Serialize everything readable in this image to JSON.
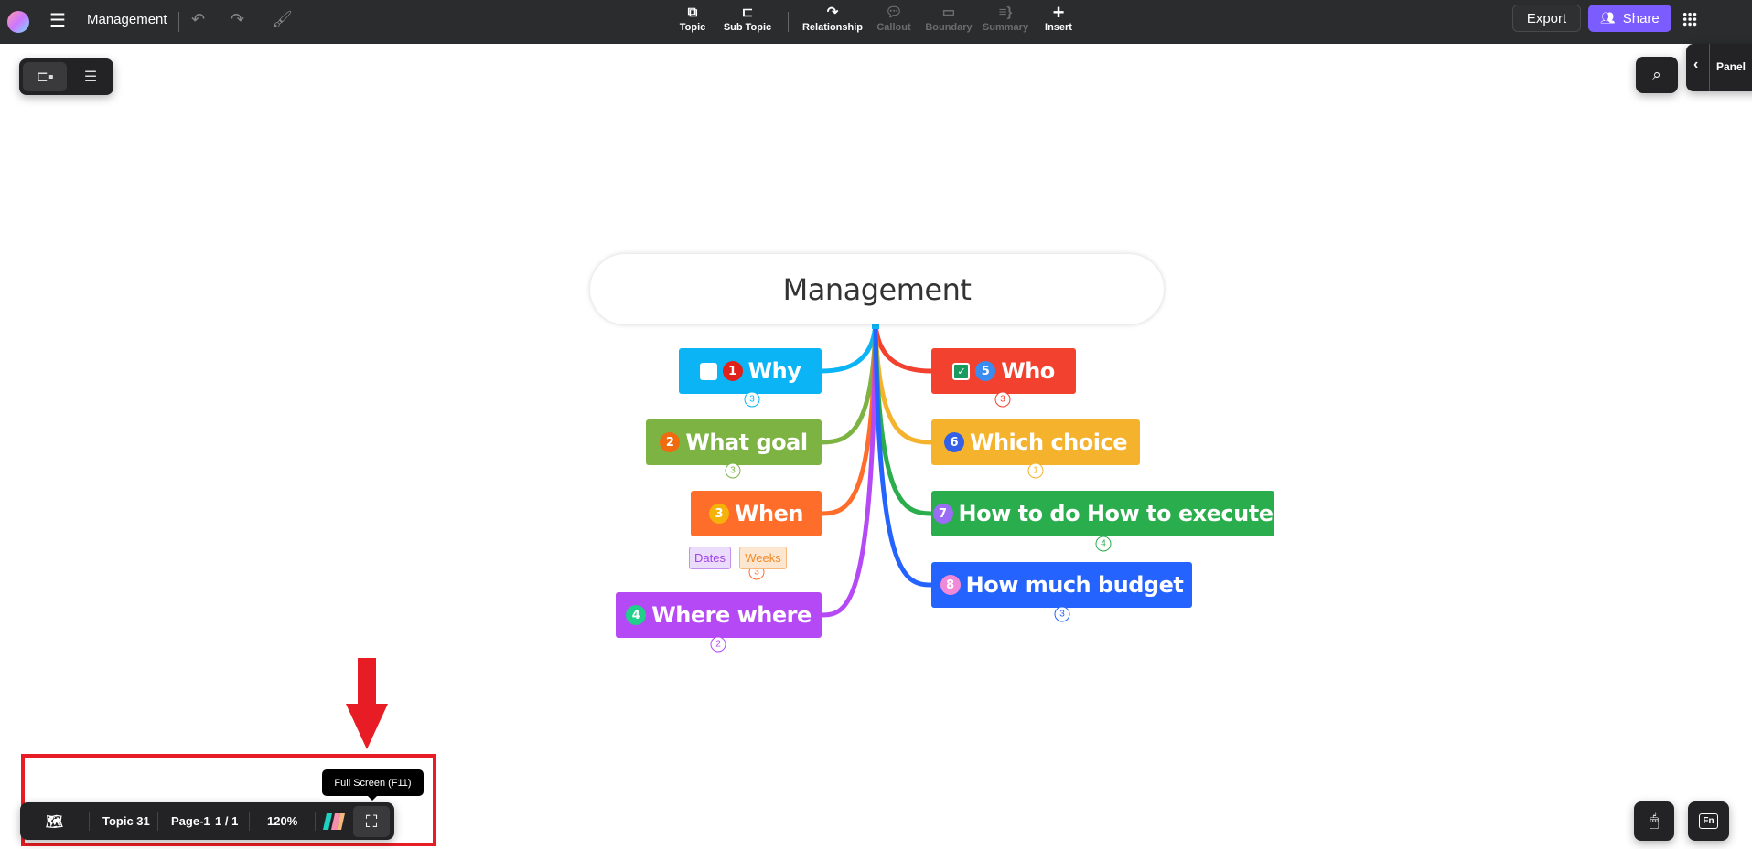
{
  "topbar": {
    "title": "Management",
    "tools": [
      {
        "label": "Topic",
        "icon": "topic-icon",
        "enabled": true
      },
      {
        "label": "Sub Topic",
        "icon": "subtopic-icon",
        "enabled": true
      },
      {
        "label": "Relationship",
        "icon": "relationship-icon",
        "enabled": true
      },
      {
        "label": "Callout",
        "icon": "callout-icon",
        "enabled": false
      },
      {
        "label": "Boundary",
        "icon": "boundary-icon",
        "enabled": false
      },
      {
        "label": "Summary",
        "icon": "summary-icon",
        "enabled": false
      },
      {
        "label": "Insert",
        "icon": "plus-icon",
        "enabled": true
      }
    ],
    "export_label": "Export",
    "share_label": "Share",
    "accent": "#7b5cff"
  },
  "panel": {
    "label": "Panel"
  },
  "map": {
    "root": "Management",
    "topics": [
      {
        "label": "Why",
        "marker": "1",
        "color": "#0bb5f5",
        "count": "3",
        "checkbox": "unchecked",
        "badge_color": "#e0201a"
      },
      {
        "label": "What goal",
        "marker": "2",
        "color": "#7cb342",
        "count": "3",
        "badge_color": "#f06a10"
      },
      {
        "label": "When",
        "marker": "3",
        "color": "#ff6d2a",
        "count": "3",
        "badge_color": "#f5b20a",
        "tags": [
          "Dates",
          "Weeks"
        ]
      },
      {
        "label": "Where where",
        "marker": "4",
        "color": "#b549f5",
        "count": "2",
        "badge_color": "#1fcf8a"
      },
      {
        "label": "Who",
        "marker": "5",
        "color": "#f2412f",
        "count": "3",
        "checkbox": "checked",
        "badge_color": "#3a8cf0"
      },
      {
        "label": "Which choice",
        "marker": "6",
        "color": "#f5b22d",
        "count": "1",
        "badge_color": "#3460e8"
      },
      {
        "label": "How to do How to execute",
        "marker": "7",
        "color": "#2aad4d",
        "count": "4",
        "badge_color": "#9b6cf5"
      },
      {
        "label": "How much budget",
        "marker": "8",
        "color": "#2563ff",
        "count": "3",
        "badge_color": "#f08ad8"
      }
    ]
  },
  "bottombar": {
    "topic_count": "Topic 31",
    "page": "Page-1",
    "page_index": "1 / 1",
    "zoom": "120%",
    "tooltip": "Full Screen (F11)"
  },
  "annotation": {
    "color": "#e81c24"
  }
}
